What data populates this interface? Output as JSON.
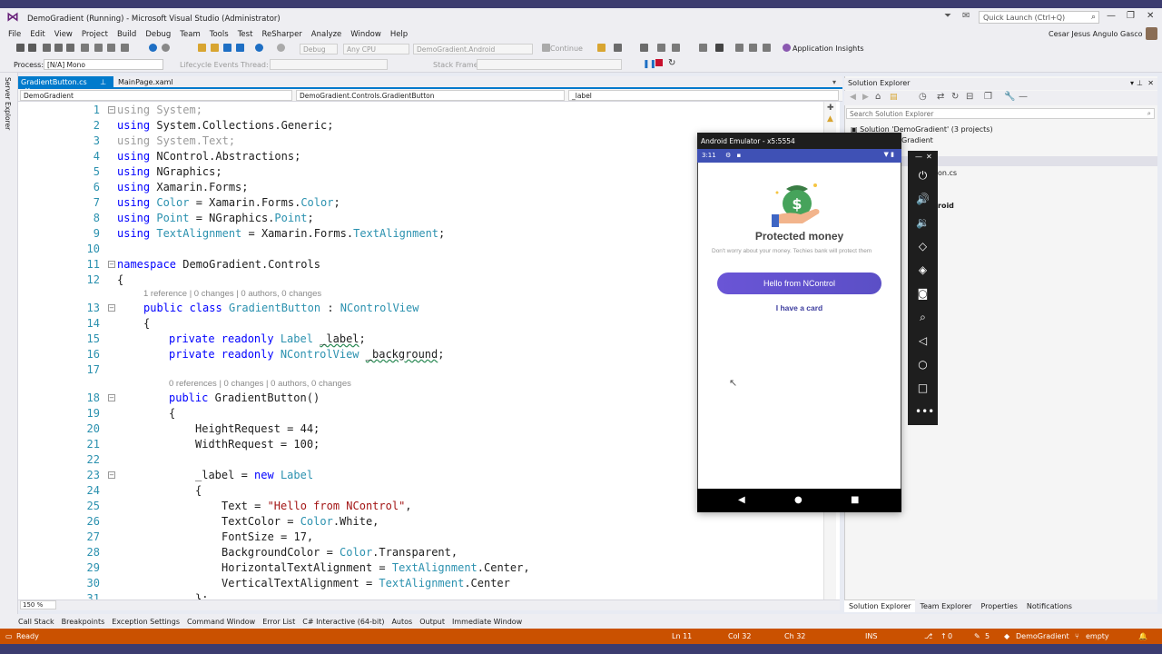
{
  "window": {
    "title": "DemoGradient (Running) - Microsoft Visual Studio  (Administrator)",
    "quick_launch_placeholder": "Quick Launch (Ctrl+Q)",
    "user": "Cesar Jesus Angulo Gasco"
  },
  "menu": [
    "File",
    "Edit",
    "View",
    "Project",
    "Build",
    "Debug",
    "Team",
    "Tools",
    "Test",
    "ReSharper",
    "Analyze",
    "Window",
    "Help"
  ],
  "toolbar": {
    "config": "Debug",
    "platform": "Any CPU",
    "startup": "DemoGradient.Android",
    "continue": "Continue",
    "app_insights": "Application Insights",
    "process_label": "Process:",
    "process_value": "[N/A] Mono",
    "lifecycle": "Lifecycle Events",
    "thread_label": "Thread:",
    "stack_label": "Stack Frame:"
  },
  "tabs": [
    {
      "label": "GradientButton.cs",
      "active": true
    },
    {
      "label": "MainPage.xaml",
      "active": false
    }
  ],
  "navbar": {
    "project": "DemoGradient",
    "type": "DemoGradient.Controls.GradientButton",
    "member": "_label"
  },
  "server_explorer": "Server Explorer",
  "lens": {
    "class": "1 reference | 0 changes | 0 authors, 0 changes",
    "ctor": "0 references | 0 changes | 0 authors, 0 changes"
  },
  "code": {
    "l1": "using System;",
    "l2a": "using",
    "l2b": " System.Collections.Generic;",
    "l3": "using System.Text;",
    "l4a": "using",
    "l4b": " NControl.Abstractions;",
    "l5a": "using",
    "l5b": " NGraphics;",
    "l6a": "using",
    "l6b": " Xamarin.Forms;",
    "l7a": "using",
    "l7b": "Color",
    "l7c": " = Xamarin.Forms.",
    "l7d": "Color",
    "l7e": ";",
    "l8a": "using",
    "l8b": "Point",
    "l8c": " = NGraphics.",
    "l8d": "Point",
    "l8e": ";",
    "l9a": "using",
    "l9b": "TextAlignment",
    "l9c": " = Xamarin.Forms.",
    "l9d": "TextAlignment",
    "l9e": ";",
    "l11a": "namespace",
    "l11b": " DemoGradient.Controls",
    "l12": "{",
    "l13a": "public class",
    "l13b": "GradientButton",
    "l13c": " : ",
    "l13d": "NControlView",
    "l14": "{",
    "l15a": "private readonly",
    "l15b": "Label",
    "l15c": "_label",
    "l15d": ";",
    "l16a": "private readonly",
    "l16b": "NControlView",
    "l16c": "_background",
    "l16d": ";",
    "l18a": "public",
    "l18b": " GradientButton()",
    "l19": "{",
    "l20": "HeightRequest = 44;",
    "l21": "WidthRequest = 100;",
    "l23a": "_label = ",
    "l23b": "new",
    "l23c": "Label",
    "l24": "{",
    "l25a": "Text = ",
    "l25b": "\"Hello from NControl\"",
    "l25c": ",",
    "l26a": "TextColor = ",
    "l26b": "Color",
    "l26c": ".White,",
    "l27": "FontSize = 17,",
    "l28a": "BackgroundColor = ",
    "l28b": "Color",
    "l28c": ".Transparent,",
    "l29a": "HorizontalTextAlignment = ",
    "l29b": "TextAlignment",
    "l29c": ".Center,",
    "l30a": "VerticalTextAlignment = ",
    "l30b": "TextAlignment",
    "l30c": ".Center",
    "l31": "};"
  },
  "line_numbers": [
    "1",
    "2",
    "3",
    "4",
    "5",
    "6",
    "7",
    "8",
    "9",
    "10",
    "11",
    "12",
    "13",
    "14",
    "15",
    "16",
    "17",
    "18",
    "19",
    "20",
    "21",
    "22",
    "23",
    "24",
    "25",
    "26",
    "27",
    "28",
    "29",
    "30",
    "31"
  ],
  "zoom": "150 %",
  "solution_explorer": {
    "title": "Solution Explorer",
    "search_placeholder": "Search Solution Explorer",
    "items": [
      "Solution 'DemoGradient' (3 projects)",
      "Gradient",
      "on.cs",
      "roid"
    ],
    "tabs": [
      "Solution Explorer",
      "Team Explorer",
      "Properties",
      "Notifications"
    ]
  },
  "emulator": {
    "title": "Android Emulator - x5:5554",
    "time": "3:11",
    "heading": "Protected money",
    "subtitle": "Don't worry about your money. Techies bank will protect them",
    "button": "Hello from NControl",
    "link": "I have a card",
    "button_color": "#6a55d6",
    "status_color": "#3f51b5"
  },
  "bottom_tabs": [
    "Call Stack",
    "Breakpoints",
    "Exception Settings",
    "Command Window",
    "Error List",
    "C# Interactive (64-bit)",
    "Autos",
    "Output",
    "Immediate Window"
  ],
  "status": {
    "ready": "Ready",
    "ln": "Ln 11",
    "col": "Col 32",
    "ch": "Ch 32",
    "ins": "INS",
    "up": "0",
    "edits": "5",
    "repo": "DemoGradient",
    "branch": "empty",
    "color": "#ca5100"
  }
}
